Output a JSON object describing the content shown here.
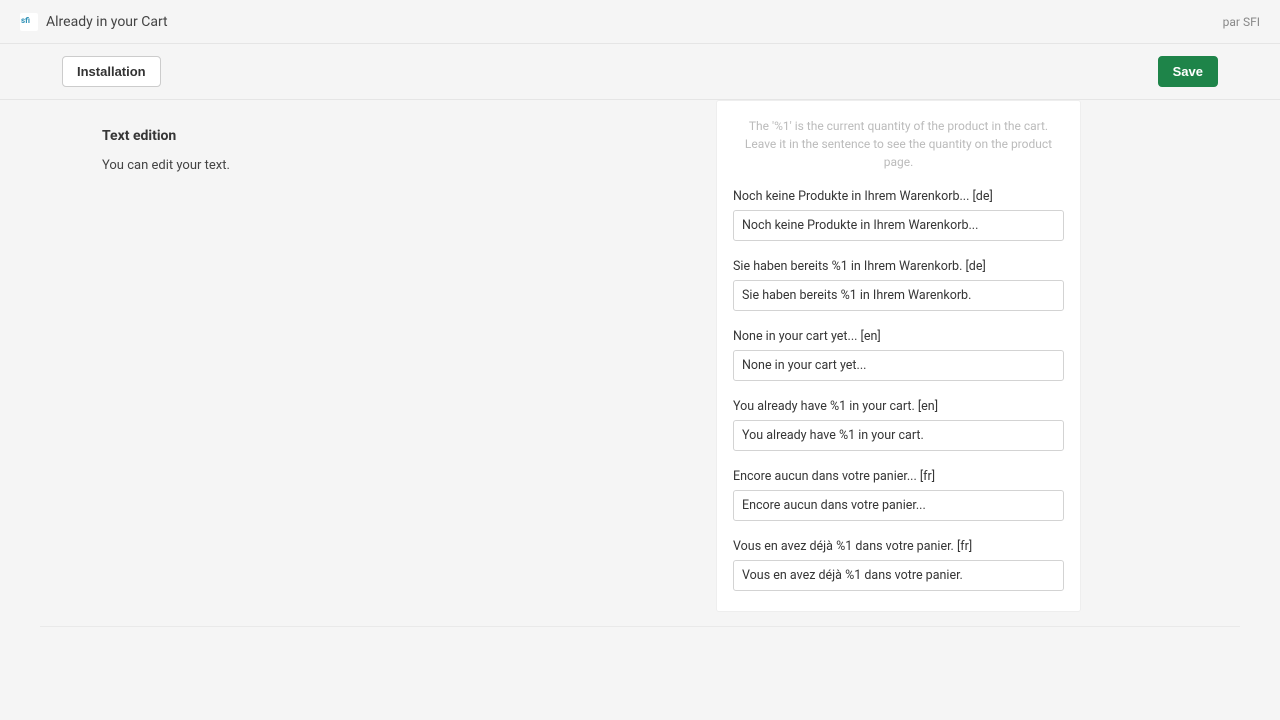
{
  "header": {
    "title": "Already in your Cart",
    "author": "par SFI"
  },
  "toolbar": {
    "installation": "Installation",
    "save": "Save"
  },
  "sidebar": {
    "title": "Text edition",
    "desc": "You can edit your text."
  },
  "panel": {
    "helper": "The '%1' is the current quantity of the product in the cart. Leave it in the sentence to see the quantity on the product page.",
    "fields": [
      {
        "label": "Noch keine Produkte in Ihrem Warenkorb... [de]",
        "value": "Noch keine Produkte in Ihrem Warenkorb..."
      },
      {
        "label": "Sie haben bereits %1 in Ihrem Warenkorb. [de]",
        "value": "Sie haben bereits %1 in Ihrem Warenkorb."
      },
      {
        "label": "None in your cart yet... [en]",
        "value": "None in your cart yet..."
      },
      {
        "label": "You already have %1 in your cart. [en]",
        "value": "You already have %1 in your cart."
      },
      {
        "label": "Encore aucun dans votre panier... [fr]",
        "value": "Encore aucun dans votre panier..."
      },
      {
        "label": "Vous en avez déjà %1 dans votre panier. [fr]",
        "value": "Vous en avez déjà %1 dans votre panier."
      }
    ]
  }
}
